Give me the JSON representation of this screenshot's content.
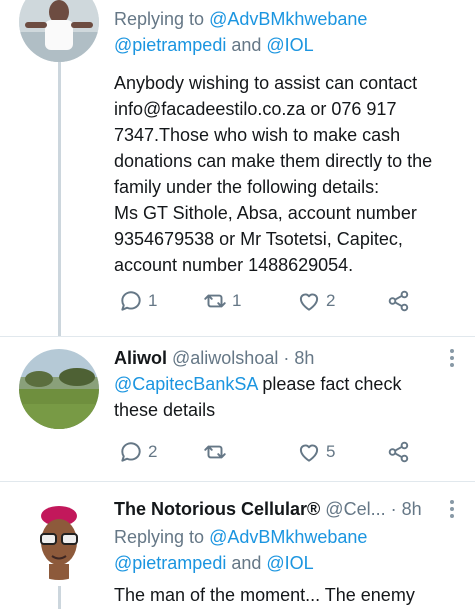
{
  "tweets": [
    {
      "replying_prefix": "Replying to ",
      "mention1": "@AdvBMkhwebane",
      "mention2": "@pietrampedi",
      "and_word": " and ",
      "mention3": "@IOL",
      "body_lines": [
        "Anybody wishing to assist can contact",
        "info@facadeestilo.co.za or 076 917",
        "7347.Those who wish to make cash",
        "donations can make them directly to the",
        "family under the following details:",
        "Ms GT Sithole, Absa, account number",
        "9354679538 or Mr Tsotetsi, Capitec,",
        "account number 1488629054."
      ],
      "reply_count": "1",
      "retweet_count": "1",
      "like_count": "2"
    },
    {
      "name": "Aliwol",
      "handle": "@aliwolshoal",
      "dot": " · ",
      "time": "8h",
      "mention": "@CapitecBankSA",
      "body_rest": " please fact check",
      "body_line2": "these details",
      "reply_count": "2",
      "retweet_count": "",
      "like_count": "5"
    },
    {
      "name": "The Notorious Cellular®",
      "handle": "@Cel...",
      "dot": " · ",
      "time": "8h",
      "replying_prefix": "Replying to ",
      "mention1": "@AdvBMkhwebane",
      "mention2": "@pietrampedi",
      "and_word": " and ",
      "mention3": "@IOL",
      "body_partial": "The man of the moment... The enemy"
    }
  ],
  "icons": {
    "reply": "reply-icon",
    "retweet": "retweet-icon",
    "like": "heart-icon",
    "share": "share-icon",
    "more": "more-vertical-icon"
  },
  "colors": {
    "link": "#1b95e0",
    "secondary": "#657786",
    "divider": "#e1e8ed",
    "thread_line": "#ccd6dd"
  }
}
